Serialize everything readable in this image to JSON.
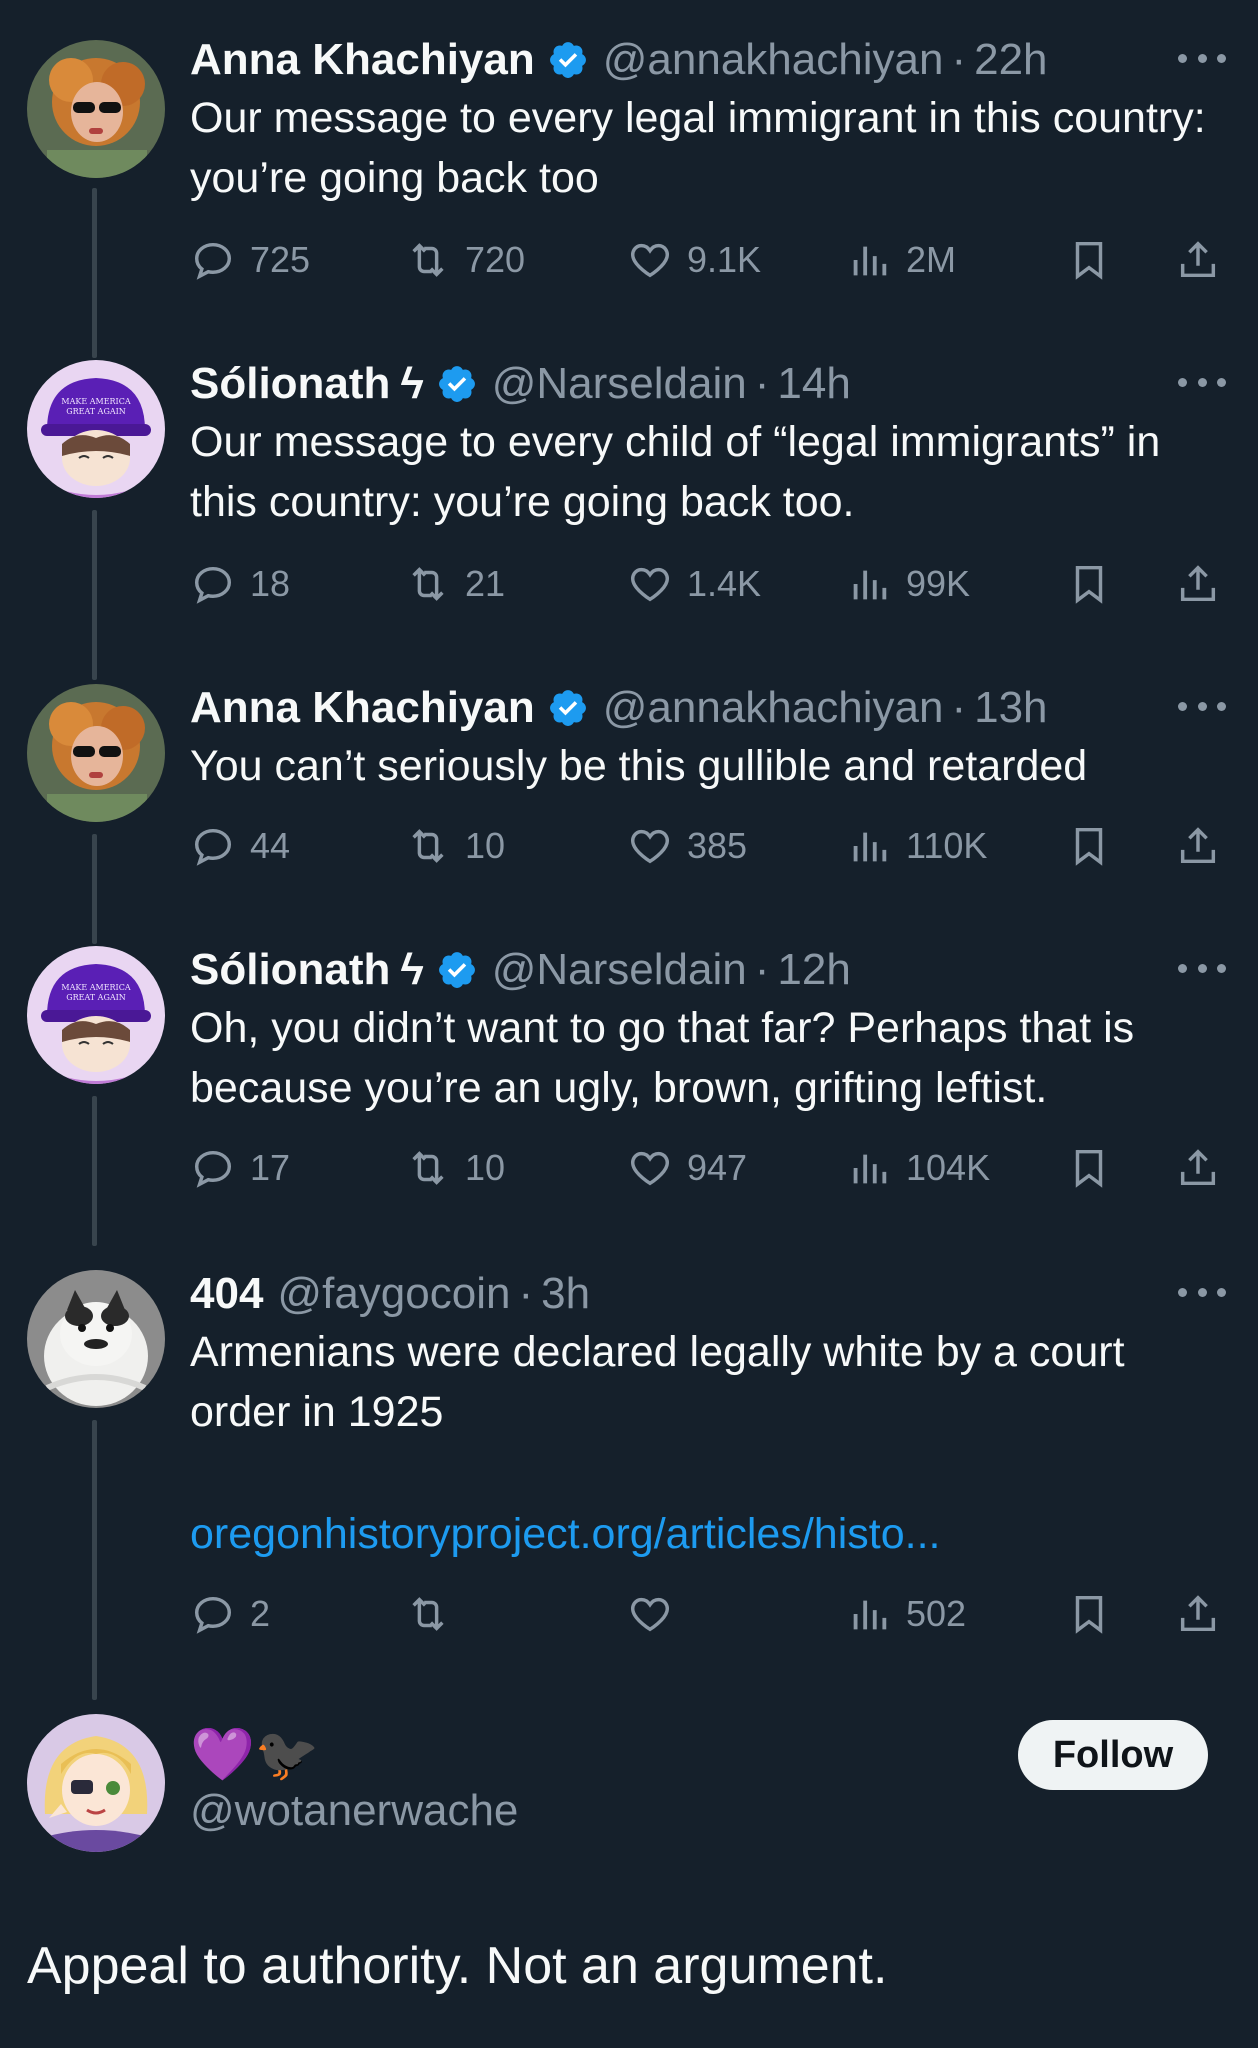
{
  "colors": {
    "background": "#15202b",
    "text": "#f7f9f9",
    "muted": "#8b98a5",
    "accent": "#1d9bf0",
    "thread_line": "#38444d",
    "follow_bg": "#eff3f4"
  },
  "tweets": [
    {
      "name": "Anna Khachiyan",
      "verified": true,
      "handle": "@annakhachiyan",
      "time": "22h",
      "text": "Our message to every legal immigrant in this country: you’re going back too",
      "replies": "725",
      "retweets": "720",
      "likes": "9.1K",
      "views": "2M",
      "avatar": "avatar-anna"
    },
    {
      "name": "Sólionath",
      "name_symbol": "ϟ",
      "verified": true,
      "handle": "@Narseldain",
      "time": "14h",
      "text": "Our message to every child of “legal immigrants” in this country: you’re going back too.",
      "replies": "18",
      "retweets": "21",
      "likes": "1.4K",
      "views": "99K",
      "avatar": "avatar-solionath"
    },
    {
      "name": "Anna Khachiyan",
      "verified": true,
      "handle": "@annakhachiyan",
      "time": "13h",
      "text": "You can’t seriously be this gullible and retarded",
      "replies": "44",
      "retweets": "10",
      "likes": "385",
      "views": "110K",
      "avatar": "avatar-anna"
    },
    {
      "name": "Sólionath",
      "name_symbol": "ϟ",
      "verified": true,
      "handle": "@Narseldain",
      "time": "12h",
      "text": "Oh, you didn’t want to go that far? Perhaps that is because you’re an ugly, brown, grifting leftist.",
      "replies": "17",
      "retweets": "10",
      "likes": "947",
      "views": "104K",
      "avatar": "avatar-solionath"
    },
    {
      "name": "404",
      "verified": false,
      "handle": "@faygocoin",
      "time": "3h",
      "text": "Armenians were declared legally white by a court order in 1925",
      "link": "oregonhistoryproject.org/articles/histo...",
      "replies": "2",
      "retweets": "",
      "likes": "",
      "views": "502",
      "avatar": "avatar-cat"
    }
  ],
  "main_reply": {
    "display_name_emojis": "💜🐦‍⬛",
    "handle": "@wotanerwache",
    "follow_label": "Follow",
    "text": "Appeal to authority. Not an argument."
  }
}
